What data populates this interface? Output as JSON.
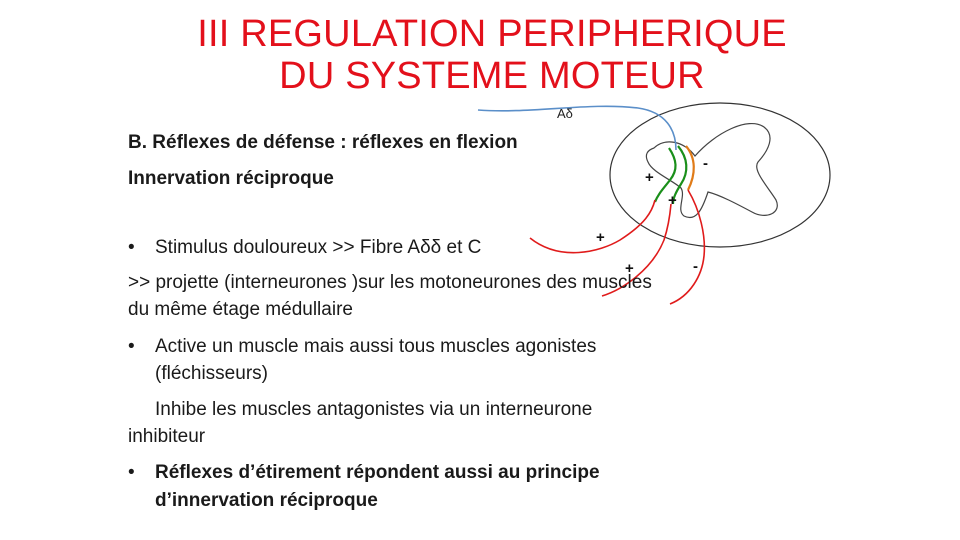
{
  "slide": {
    "title_line1": "III REGULATION PERIPHERIQUE",
    "title_line2": "DU SYSTEME MOTEUR",
    "heading_section": "B. Réflexes de défense : réflexes en flexion",
    "heading_sub": "Innervation réciproque",
    "bullet_char": "•",
    "bullet1": "Stimulus douloureux >> Fibre Aδδ et C",
    "line2a": " >>  projette   (interneurones )sur les motoneurones des muscles",
    "line2b": "du même étage médullaire",
    "bullet2a": "Active un muscle mais aussi tous muscles agonistes",
    "bullet2b": "(fléchisseurs)",
    "line3a": "  Inhibe les muscles antagonistes via un interneurone",
    "line3b": "inhibiteur",
    "bullet3a": " Réflexes d’étirement répondent aussi au principe",
    "bullet3b": "d’innervation réciproque"
  },
  "diagram": {
    "fiber_label": "Aδ",
    "plus": "+",
    "minus": "-",
    "colors": {
      "afferent_fiber": "#5b8fc9",
      "excitatory": "#1a8f1a",
      "inhibitory": "#e07b18",
      "motor": "#e01b1b",
      "outline": "#333333"
    }
  }
}
